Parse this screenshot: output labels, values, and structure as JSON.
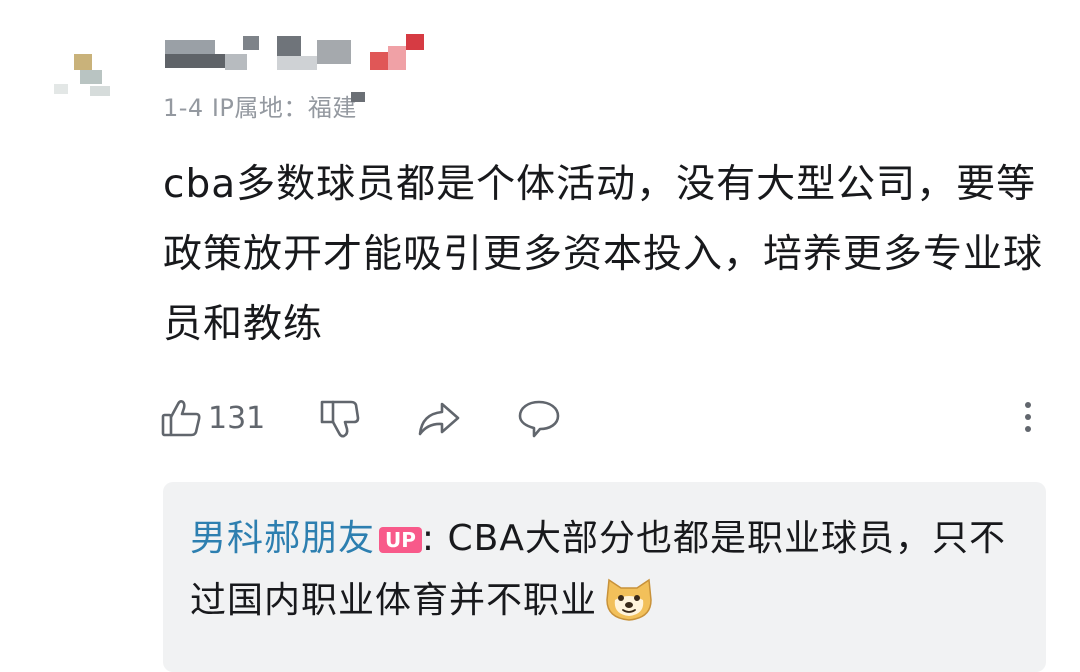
{
  "comment": {
    "meta": "1-4  IP属地：",
    "ip_location": "福建",
    "content": "cba多数球员都是个体活动，没有大型公司，要等政策放开才能吸引更多资本投入，培养更多专业球员和教练",
    "like_count": "131"
  },
  "reply": {
    "username": "男科郝朋友",
    "badge": "UP",
    "colon": ":",
    "text": " CBA大部分也都是职业球员，只不过国内职业体育并不职业"
  },
  "icons": {
    "like": "thumbs-up-icon",
    "dislike": "thumbs-down-icon",
    "share": "share-icon",
    "reply": "comment-icon",
    "more": "more-vertical-icon",
    "emoji": "doge-emoji-icon"
  },
  "colors": {
    "reply_username": "#2d7fb0",
    "up_badge": "#f85a8a",
    "meta_text": "#9499a0",
    "reply_bg": "#f1f2f3"
  }
}
